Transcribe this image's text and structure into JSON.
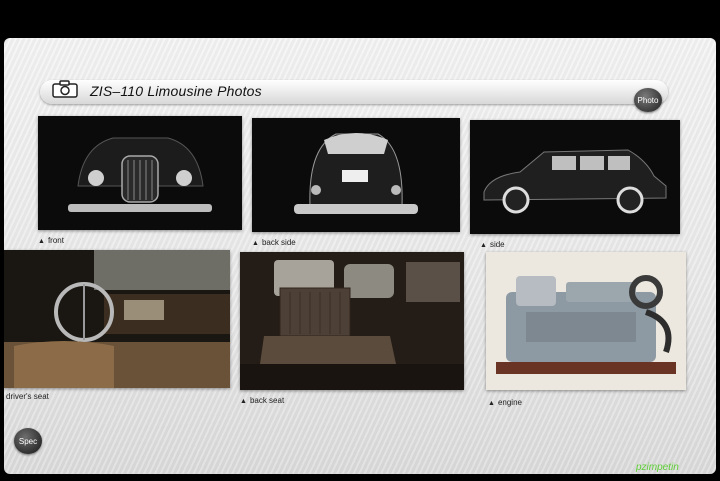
{
  "header": {
    "title": "ZIS–110 Limousine Photos",
    "photo_button_label": "Photo",
    "camera_icon": "camera-icon"
  },
  "gallery": {
    "items": [
      {
        "caption": "front"
      },
      {
        "caption": "back side"
      },
      {
        "caption": "side"
      },
      {
        "caption": "driver's seat"
      },
      {
        "caption": "back seat"
      },
      {
        "caption": "engine"
      }
    ],
    "caption_marker": "▲"
  },
  "footer": {
    "spec_button_label": "Spec",
    "watermark": "pzimpetin"
  },
  "colors": {
    "photo_bg": "#0c0c0c",
    "accent_text": "#111111",
    "watermark": "#5fcf37"
  }
}
